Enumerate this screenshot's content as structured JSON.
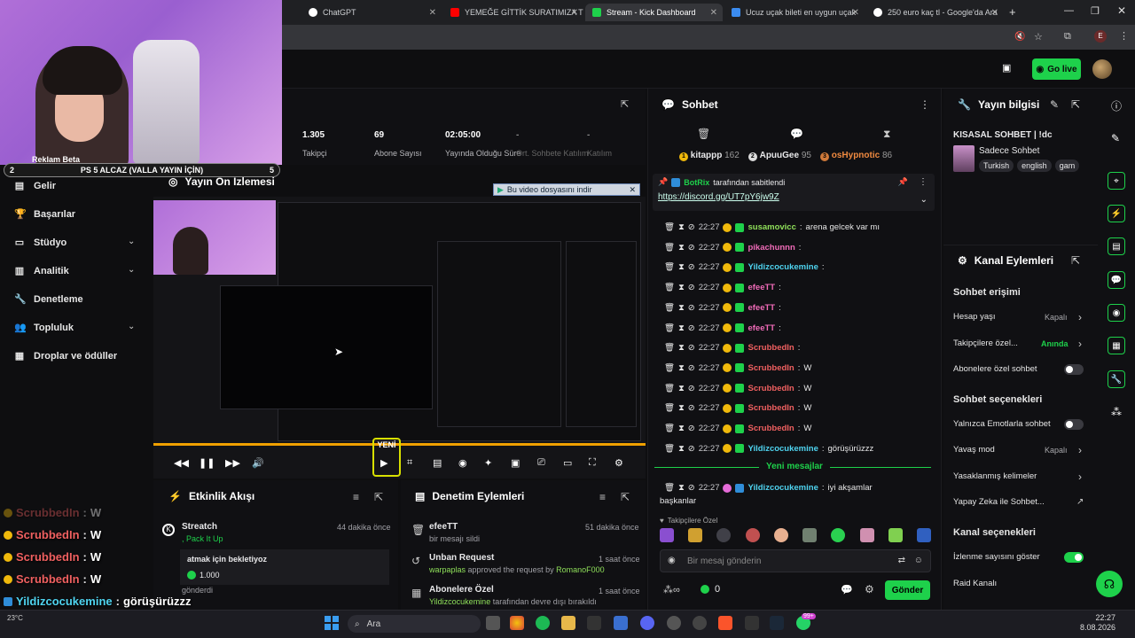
{
  "browser": {
    "tabs": [
      {
        "label": "ChatGPT",
        "color": "#ffffff"
      },
      {
        "label": "YEMEĞE GİTTİK SURATIMIZA TÜ",
        "color": "#ff0000"
      },
      {
        "label": "Stream - Kick Dashboard",
        "color": "#1ed14b"
      },
      {
        "label": "Ucuz uçak bileti en uygun uçak",
        "color": "#3b8cf0"
      },
      {
        "label": "250 euro kaç tl - Google'da Ara",
        "color": "#ffffff"
      }
    ]
  },
  "header": {
    "go_live": "Go live"
  },
  "webcam": {
    "alert_num": "2",
    "alert_text": "PS 5 ALCAZ (VALLA YAYIN İÇİN)",
    "alert_right": "5",
    "obscured": "Reklam  Beta"
  },
  "sidebar": {
    "items": [
      {
        "label": "Gelir"
      },
      {
        "label": "Başarılar"
      },
      {
        "label": "Stüdyo"
      },
      {
        "label": "Analitik"
      },
      {
        "label": "Denetleme"
      },
      {
        "label": "Topluluk"
      },
      {
        "label": "Droplar ve ödüller"
      }
    ]
  },
  "stats": [
    {
      "value": "1.305",
      "label": "Takipçi"
    },
    {
      "value": "69",
      "label": "Abone Sayısı"
    },
    {
      "value": "02:05:00",
      "label": "Yayında Olduğu Süre"
    },
    {
      "value": "-",
      "label": "Ort. Sohbete Katılım"
    },
    {
      "value": "-",
      "label": "Katılım"
    }
  ],
  "preview": {
    "title": "Yayın Ön İzlemesi",
    "download": "Bu video dosyasını indir",
    "new_label": "YENİ"
  },
  "activity": {
    "title": "Etkinlik Akışı",
    "item_name": "Streatch",
    "item_sub": ", Pack It Up",
    "item_time": "44 dakika önce",
    "msg": "atmak için bekletiyoz",
    "amount": "1.000",
    "sent": "gönderdi"
  },
  "moderation": {
    "title": "Denetim Eylemleri",
    "items": [
      {
        "name": "efeeTT",
        "desc": "bir mesajı sildi",
        "time": "51 dakika önce"
      },
      {
        "name": "Unban Request",
        "desc_user": "warpaplas",
        "desc": "approved the request by",
        "desc_target": "RomanoF000",
        "time": "1 saat önce"
      },
      {
        "name": "Abonelere Özel",
        "desc_user": "Yildizcocukemine",
        "desc": "tarafından devre dışı bırakıldı",
        "time": "1 saat önce"
      }
    ]
  },
  "chat": {
    "title": "Sohbet",
    "top_users": [
      {
        "name": "kitappp",
        "count": "162"
      },
      {
        "name": "ApuuGee",
        "count": "95"
      },
      {
        "name": "osHypnotic",
        "count": "86"
      }
    ],
    "pinned_by": "BotRix",
    "pinned_label": "tarafından sabitlendi",
    "pinned_link": "https://discord.gg/UT7pY6jw9Z",
    "messages": [
      {
        "time": "22:27",
        "user": "susamovicc",
        "text": "arena gelcek var mı",
        "color": "green"
      },
      {
        "time": "22:27",
        "user": "pikachunnn",
        "text": "",
        "color": "pink"
      },
      {
        "time": "22:27",
        "user": "Yildizcocukemine",
        "text": "",
        "color": "cyan"
      },
      {
        "time": "22:27",
        "user": "efeeTT",
        "text": "",
        "color": "pink"
      },
      {
        "time": "22:27",
        "user": "efeeTT",
        "text": "",
        "color": "pink"
      },
      {
        "time": "22:27",
        "user": "efeeTT",
        "text": "",
        "color": "pink"
      },
      {
        "time": "22:27",
        "user": "ScrubbedIn",
        "text": "",
        "color": "red"
      },
      {
        "time": "22:27",
        "user": "ScrubbedIn",
        "text": "W",
        "color": "red"
      },
      {
        "time": "22:27",
        "user": "ScrubbedIn",
        "text": "W",
        "color": "red"
      },
      {
        "time": "22:27",
        "user": "ScrubbedIn",
        "text": "W",
        "color": "red"
      },
      {
        "time": "22:27",
        "user": "ScrubbedIn",
        "text": "W",
        "color": "red"
      },
      {
        "time": "22:27",
        "user": "Yildizcocukemine",
        "text": "görüşürüzzz",
        "color": "cyan"
      }
    ],
    "new_messages": "Yeni mesajlar",
    "last_msg": {
      "time": "22:27",
      "user": "Yildizcocukemine",
      "text": "iyi akşamlar",
      "text2": "başkanlar"
    },
    "followers_only": "Takipçilere Özel",
    "input_placeholder": "Bir mesaj gönderin",
    "viewer_count": "0",
    "send": "Gönder"
  },
  "stream_info": {
    "title": "Yayın bilgisi",
    "stream_title": "KISASAL SOHBET | !dc",
    "category": "Sadece Sohbet",
    "tags": [
      "Turkish",
      "english",
      "gam"
    ]
  },
  "channel_actions": {
    "title": "Kanal Eylemleri",
    "chat_access": "Sohbet erişimi",
    "rows1": [
      {
        "label": "Hesap yaşı",
        "value": "Kapalı"
      },
      {
        "label": "Takipçilere özel...",
        "value": "Anında"
      },
      {
        "label": "Abonelere özel sohbet",
        "value": ""
      }
    ],
    "chat_options": "Sohbet seçenekleri",
    "rows2": [
      {
        "label": "Yalnızca Emotlarla sohbet",
        "value": ""
      },
      {
        "label": "Yavaş mod",
        "value": "Kapalı"
      },
      {
        "label": "Yasaklanmış kelimeler",
        "value": ""
      },
      {
        "label": "Yapay Zeka ile Sohbet...",
        "value": ""
      }
    ],
    "channel_options": "Kanal seçenekleri",
    "rows3": [
      {
        "label": "İzlenme sayısını göster",
        "value": ""
      },
      {
        "label": "Raid Kanalı",
        "value": ""
      }
    ]
  },
  "overlay_chat": [
    {
      "user": "ScrubbedIn",
      "text": "W"
    },
    {
      "user": "ScrubbedIn",
      "text": "W"
    },
    {
      "user": "ScrubbedIn",
      "text": "W"
    },
    {
      "user": "ScrubbedIn",
      "text": "W"
    },
    {
      "user": "Yildizcocukemine",
      "text": "görüşürüzzz"
    },
    {
      "user": "Yildizcocukemine",
      "text": "iyi akşamlar başkanlar"
    }
  ],
  "taskbar": {
    "search": "Ara",
    "weather": "23°C",
    "time": "22:27",
    "date": "8.08.2026",
    "badge": "99+"
  }
}
